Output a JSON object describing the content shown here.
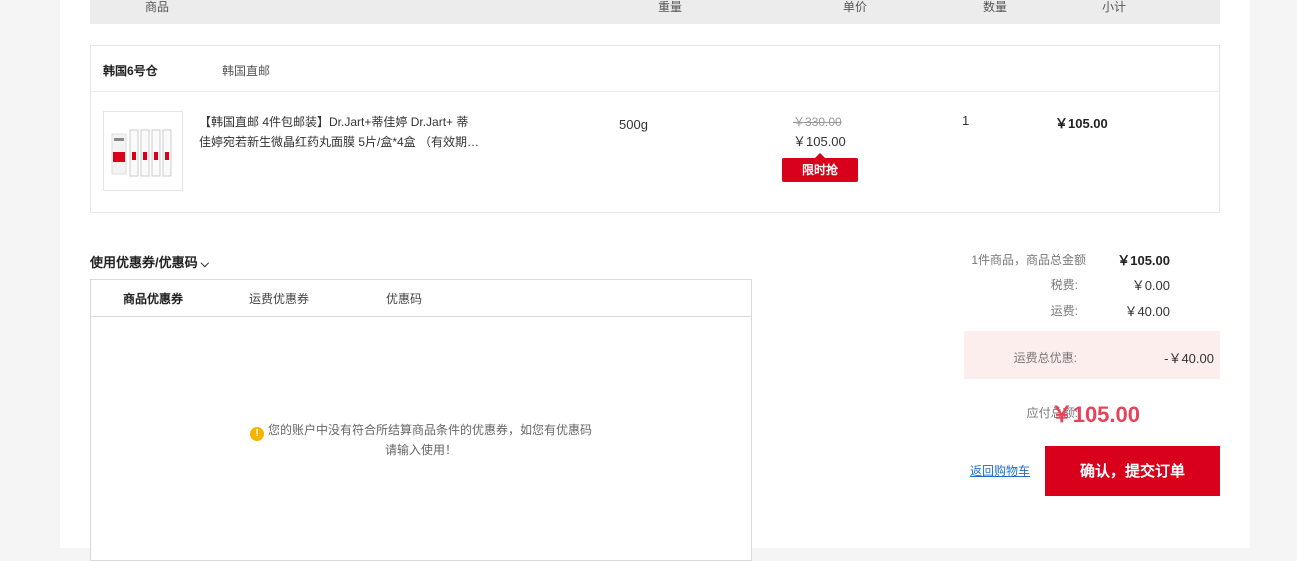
{
  "table_header": {
    "product": "商品",
    "weight": "重量",
    "unit_price": "单价",
    "quantity": "数量",
    "subtotal": "小计"
  },
  "warehouse": {
    "name": "韩国6号仓",
    "type": "韩国直邮"
  },
  "item": {
    "name_line1": "【韩国直邮 4件包邮装】Dr.Jart+蒂佳婷 Dr.Jart+ 蒂",
    "name_line2": "佳婷宛若新生微晶红药丸面膜 5片/盒*4盒 （有效期…",
    "weight": "500g",
    "original_price": "￥330.00",
    "current_price": "￥105.00",
    "flash_sale_label": "限时抢",
    "quantity": "1",
    "subtotal": "￥105.00",
    "image_icon": "product-thumbnail"
  },
  "coupon": {
    "title": "使用优惠券/优惠码",
    "tabs": [
      {
        "label": "商品优惠券"
      },
      {
        "label": "运费优惠券"
      },
      {
        "label": "优惠码"
      }
    ],
    "empty_line1": "您的账户中没有符合所结算商品条件的优惠券，如您有优惠码",
    "empty_line2": "请输入使用！"
  },
  "summary": {
    "items_label": "1件商品，商品总金额",
    "items_value": "￥105.00",
    "tax_label": "税费:",
    "tax_value": "￥0.00",
    "shipping_label": "运费:",
    "shipping_value": "￥40.00",
    "shipping_discount_label": "运费总优惠:",
    "shipping_discount_value": "-￥40.00",
    "total_label": "应付总额:",
    "total_value": "￥105.00"
  },
  "actions": {
    "back_to_cart": "返回购物车",
    "submit": "确认，提交订单"
  },
  "colors": {
    "accent": "#d9001b",
    "total_price": "#e8435a",
    "link": "#1d6fc5"
  }
}
